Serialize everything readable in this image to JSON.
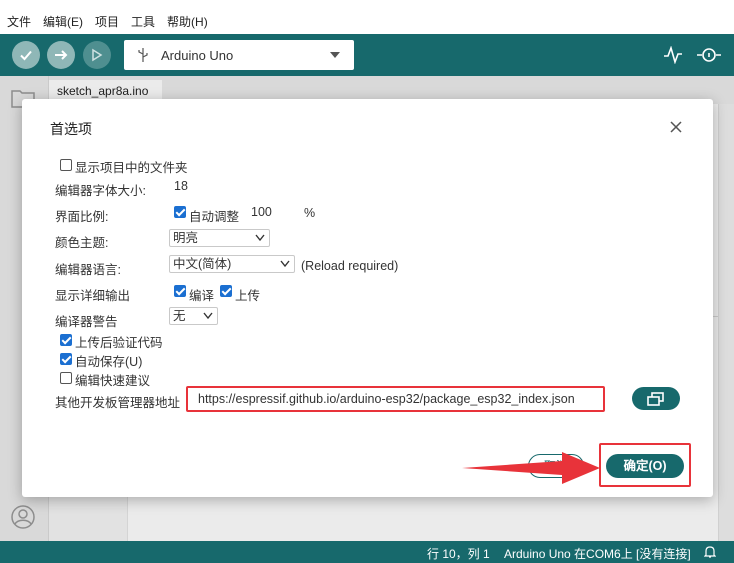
{
  "menubar": {
    "items": [
      "文件",
      "编辑(E)",
      "项目",
      "工具",
      "帮助(H)"
    ]
  },
  "toolbar": {
    "board": "Arduino Uno"
  },
  "editor": {
    "tab": "sketch_apr8a.ino"
  },
  "status": {
    "position": "行 10，列 1",
    "board": "Arduino Uno 在COM6上 [没有连接]"
  },
  "dialog": {
    "title": "首选项",
    "show_sketch_files": {
      "label": "显示项目中的文件夹",
      "checked": false
    },
    "font_size": {
      "label": "编辑器字体大小:",
      "value": "18"
    },
    "interface_scale": {
      "label": "界面比例:",
      "auto_label": "自动调整",
      "auto_checked": true,
      "value": "100",
      "unit": "%"
    },
    "theme": {
      "label": "颜色主题:",
      "value": "明亮"
    },
    "language": {
      "label": "编辑器语言:",
      "value": "中文(简体)",
      "note": "(Reload required)"
    },
    "verbose": {
      "label": "显示详细输出",
      "compile_label": "编译",
      "compile_checked": true,
      "upload_label": "上传",
      "upload_checked": true
    },
    "warnings": {
      "label": "编译器警告",
      "value": "无"
    },
    "verify_after_upload": {
      "label": "上传后验证代码",
      "checked": true
    },
    "auto_save": {
      "label": "自动保存(U)",
      "checked": true
    },
    "quick_suggestions": {
      "label": "编辑快速建议",
      "checked": false
    },
    "board_urls": {
      "label": "其他开发板管理器地址",
      "value": "https://espressif.github.io/arduino-esp32/package_esp32_index.json"
    },
    "cancel_label": "取消",
    "ok_label": "确定(O)"
  },
  "colors": {
    "accent": "#17696c",
    "highlight": "#e8333a",
    "checkbox": "#1b6fd1"
  }
}
